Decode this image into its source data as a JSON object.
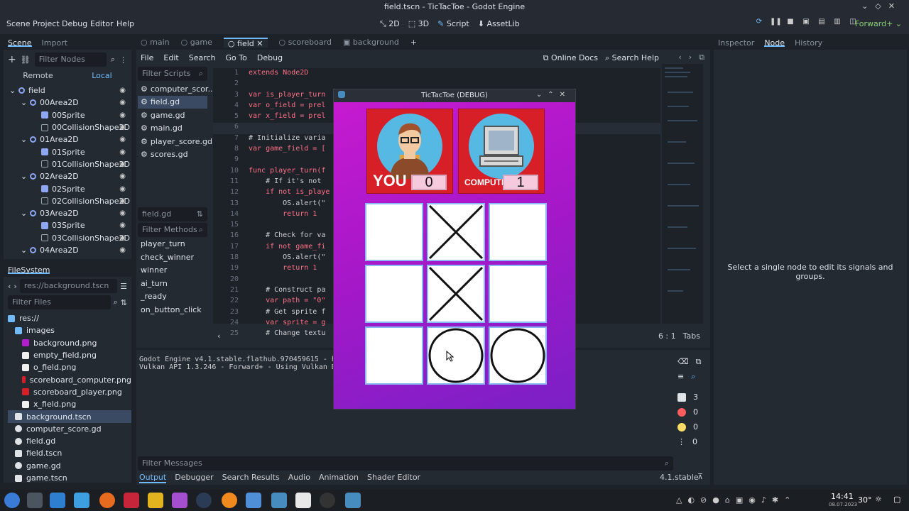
{
  "window_title": "field.tscn - TicTacToe - Godot Engine",
  "menu": [
    "Scene",
    "Project",
    "Debug",
    "Editor",
    "Help"
  ],
  "modes": [
    "2D",
    "3D",
    "Script",
    "AssetLib"
  ],
  "renderer": "Forward+",
  "scene_dock": {
    "tabs": [
      "Scene",
      "Import"
    ],
    "filter_placeholder": "Filter Nodes",
    "remote": "Remote",
    "local": "Local",
    "nodes": [
      {
        "label": "field",
        "type": "node2d",
        "indent": 0
      },
      {
        "label": "00Area2D",
        "type": "area",
        "indent": 1
      },
      {
        "label": "00Sprite",
        "type": "sprite",
        "indent": 2
      },
      {
        "label": "00CollisionShape2D",
        "type": "col",
        "indent": 2
      },
      {
        "label": "01Area2D",
        "type": "area",
        "indent": 1
      },
      {
        "label": "01Sprite",
        "type": "sprite",
        "indent": 2
      },
      {
        "label": "01CollisionShape2D",
        "type": "col",
        "indent": 2
      },
      {
        "label": "02Area2D",
        "type": "area",
        "indent": 1
      },
      {
        "label": "02Sprite",
        "type": "sprite",
        "indent": 2
      },
      {
        "label": "02CollisionShape2D",
        "type": "col",
        "indent": 2
      },
      {
        "label": "03Area2D",
        "type": "area",
        "indent": 1
      },
      {
        "label": "03Sprite",
        "type": "sprite",
        "indent": 2
      },
      {
        "label": "03CollisionShape2D",
        "type": "col",
        "indent": 2
      },
      {
        "label": "04Area2D",
        "type": "area",
        "indent": 1
      }
    ]
  },
  "filesystem": {
    "tab": "FileSystem",
    "path": "res://background.tscn",
    "filter_placeholder": "Filter Files",
    "items": [
      {
        "label": "res://",
        "kind": "folder",
        "indent": 0
      },
      {
        "label": "images",
        "kind": "folder",
        "indent": 1
      },
      {
        "label": "background.png",
        "kind": "img-purple",
        "indent": 2
      },
      {
        "label": "empty_field.png",
        "kind": "img-white",
        "indent": 2
      },
      {
        "label": "o_field.png",
        "kind": "img-white",
        "indent": 2
      },
      {
        "label": "scoreboard_computer.png",
        "kind": "img-red",
        "indent": 2
      },
      {
        "label": "scoreboard_player.png",
        "kind": "img-red",
        "indent": 2
      },
      {
        "label": "x_field.png",
        "kind": "img-x",
        "indent": 2
      },
      {
        "label": "background.tscn",
        "kind": "scene",
        "indent": 1,
        "selected": true
      },
      {
        "label": "computer_score.gd",
        "kind": "gear",
        "indent": 1
      },
      {
        "label": "field.gd",
        "kind": "gear",
        "indent": 1
      },
      {
        "label": "field.tscn",
        "kind": "scene",
        "indent": 1
      },
      {
        "label": "game.gd",
        "kind": "gear",
        "indent": 1
      },
      {
        "label": "game.tscn",
        "kind": "scene",
        "indent": 1
      }
    ]
  },
  "editor_tabs": [
    "main",
    "game",
    "field",
    "scoreboard",
    "background"
  ],
  "script_menu": [
    "File",
    "Edit",
    "Search",
    "Go To",
    "Debug"
  ],
  "online_docs": "Online Docs",
  "search_help": "Search Help",
  "filter_scripts": "Filter Scripts",
  "scripts": [
    "computer_scor...",
    "field.gd",
    "game.gd",
    "main.gd",
    "player_score.gd",
    "scores.gd"
  ],
  "current_script": "field.gd",
  "filter_methods": "Filter Methods",
  "methods": [
    "player_turn",
    "check_winner",
    "winner",
    "ai_turn",
    "_ready",
    "on_button_click"
  ],
  "code_lines": [
    {
      "n": "1",
      "t": "extends Node2D"
    },
    {
      "n": "2",
      "t": ""
    },
    {
      "n": "3",
      "t": "var is_player_turn"
    },
    {
      "n": "4",
      "t": "var o_field = prel"
    },
    {
      "n": "5",
      "t": "var x_field = prel"
    },
    {
      "n": "6",
      "t": ""
    },
    {
      "n": "7",
      "t": "# Initialize varia"
    },
    {
      "n": "8",
      "t": "var game_field = ["
    },
    {
      "n": "9",
      "t": ""
    },
    {
      "n": "10",
      "t": "func player_turn(f"
    },
    {
      "n": "11",
      "t": "    # If it's not"
    },
    {
      "n": "12",
      "t": "    if not is_playe"
    },
    {
      "n": "13",
      "t": "        OS.alert(\""
    },
    {
      "n": "14",
      "t": "        return 1"
    },
    {
      "n": "15",
      "t": ""
    },
    {
      "n": "16",
      "t": "    # Check for va"
    },
    {
      "n": "17",
      "t": "    if not game_fi"
    },
    {
      "n": "18",
      "t": "        OS.alert(\""
    },
    {
      "n": "19",
      "t": "        return 1"
    },
    {
      "n": "20",
      "t": ""
    },
    {
      "n": "21",
      "t": "    # Construct pa"
    },
    {
      "n": "22",
      "t": "    var path = \"0\""
    },
    {
      "n": "23",
      "t": "    # Get sprite f"
    },
    {
      "n": "24",
      "t": "    var sprite = g"
    },
    {
      "n": "25",
      "t": "    # Change textu"
    }
  ],
  "cursor_pos": "6 :    1",
  "indent_mode": "Tabs",
  "output_lines": [
    "Godot Engine v4.1.stable.flathub.970459615 - https://",
    "Vulkan API 1.3.246 - Forward+ - Using Vulkan Device #"
  ],
  "filter_messages": "Filter Messages",
  "bottom_tabs": [
    "Output",
    "Debugger",
    "Search Results",
    "Audio",
    "Animation",
    "Shader Editor"
  ],
  "version": "4.1.stable",
  "counters": {
    "messages": "3",
    "errors": "0",
    "warnings": "0",
    "info": "0"
  },
  "inspector": {
    "tabs": [
      "Inspector",
      "Node",
      "History"
    ],
    "message": "Select a single node to edit its signals and groups."
  },
  "game_window": {
    "title": "TicTacToe (DEBUG)",
    "player_label": "YOU",
    "player_score": "0",
    "computer_label": "COMPUTER",
    "computer_score": "1",
    "board": [
      "",
      "X",
      "",
      "",
      "X",
      "",
      "",
      "O",
      "O"
    ]
  },
  "taskbar": {
    "time": "14:41",
    "date": "08.07.2023",
    "temp": "30°"
  }
}
